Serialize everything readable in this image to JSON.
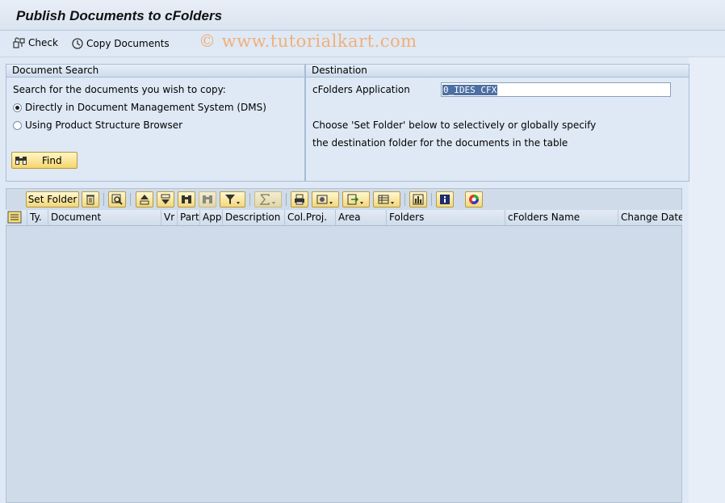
{
  "window": {
    "title": "Publish Documents to cFolders"
  },
  "appbar": {
    "check_label": "Check",
    "copy_label": "Copy Documents"
  },
  "watermark": "© www.tutorialkart.com",
  "document_search": {
    "header": "Document Search",
    "prompt": "Search for the documents you wish to copy:",
    "options": [
      "Directly in Document Management System (DMS)",
      "Using Product Structure Browser"
    ],
    "selected_index": 0,
    "find_label": "Find"
  },
  "destination": {
    "header": "Destination",
    "app_label": "cFolders Application",
    "app_value": "0_IDES CFX",
    "info_line1": "Choose 'Set Folder' below to selectively or globally specify",
    "info_line2": "the destination folder for the documents in the table"
  },
  "toolbar": {
    "set_folder_label": "Set Folder"
  },
  "table": {
    "columns": [
      "Ty.",
      "Document",
      "Vr",
      "Part",
      "App",
      "Description",
      "Col.Proj.",
      "Area",
      "Folders",
      "cFolders Name",
      "Change Date"
    ]
  },
  "icons": {
    "check": "check-icon",
    "copy": "copy-documents-icon",
    "find": "binoculars-icon",
    "delete": "trash-icon",
    "details": "magnifier-icon",
    "sort_asc": "sort-ascending-icon",
    "sort_desc": "sort-descending-icon",
    "find_grid": "find-icon",
    "find_next": "find-next-icon",
    "filter": "filter-icon",
    "sum": "sum-icon",
    "print": "print-icon",
    "views": "views-icon",
    "export": "export-icon",
    "layout": "layout-icon",
    "graphic": "graphic-icon",
    "info": "info-icon",
    "color": "color-legend-icon",
    "select_all": "select-all-icon"
  },
  "colors": {
    "background": "#dfe9f5",
    "button": "#f3d77a",
    "watermark": "#f0b07a"
  }
}
